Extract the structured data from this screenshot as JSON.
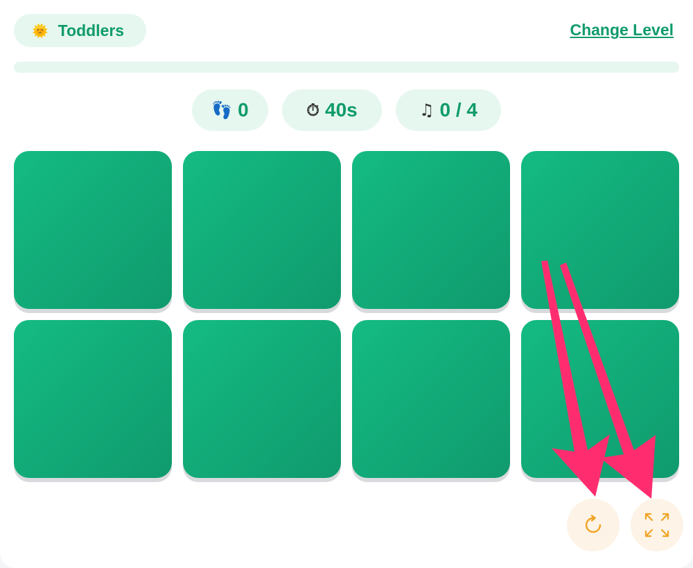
{
  "header": {
    "level_emoji": "🌞",
    "level_label": "Toddlers",
    "change_level_label": "Change Level"
  },
  "progress": {
    "fraction": 0
  },
  "stats": [
    {
      "icon": "footprints-icon",
      "glyph": "👣",
      "value": "0"
    },
    {
      "icon": "stopwatch-icon",
      "glyph": "⏱",
      "value": "40s"
    },
    {
      "icon": "music-note-icon",
      "glyph": "♫",
      "value": "0 / 4"
    }
  ],
  "board": {
    "rows": 2,
    "cols": 4,
    "cards": [
      {
        "state": "face-down"
      },
      {
        "state": "face-down"
      },
      {
        "state": "face-down"
      },
      {
        "state": "face-down"
      },
      {
        "state": "face-down"
      },
      {
        "state": "face-down"
      },
      {
        "state": "face-down"
      },
      {
        "state": "face-down"
      }
    ]
  },
  "controls": {
    "restart_icon": "restart-icon",
    "fullscreen_icon": "fullscreen-icon"
  },
  "colors": {
    "accent": "#0f9b6b",
    "card": "#12b27d",
    "pill_bg": "#e6f7ef",
    "control_bg": "#fdf3e6",
    "control_icon": "#f0a323",
    "annotation_arrow": "#ff2d6f"
  }
}
